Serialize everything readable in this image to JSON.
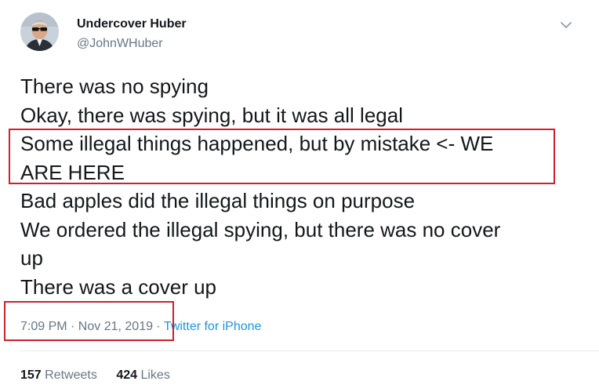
{
  "user": {
    "display_name": "Undercover Huber",
    "handle": "@JohnWHuber"
  },
  "tweet": {
    "lines": [
      "There was no spying",
      "Okay, there was spying, but it was all legal",
      "Some illegal things happened, but by mistake <- WE",
      "ARE HERE",
      "Bad apples did the illegal things on purpose",
      "We ordered the illegal spying, but there was no cover",
      "up",
      "There was a cover up"
    ],
    "timestamp": "7:09 PM · Nov 21, 2019",
    "separator": " · ",
    "source": "Twitter for iPhone"
  },
  "stats": {
    "retweets_count": "157",
    "retweets_label": "Retweets",
    "likes_count": "424",
    "likes_label": "Likes"
  },
  "icons": {
    "more": "chevron-down-icon"
  },
  "colors": {
    "text": "#14171a",
    "muted": "#657786",
    "link": "#1b95e0",
    "annotation": "#d0202a"
  }
}
